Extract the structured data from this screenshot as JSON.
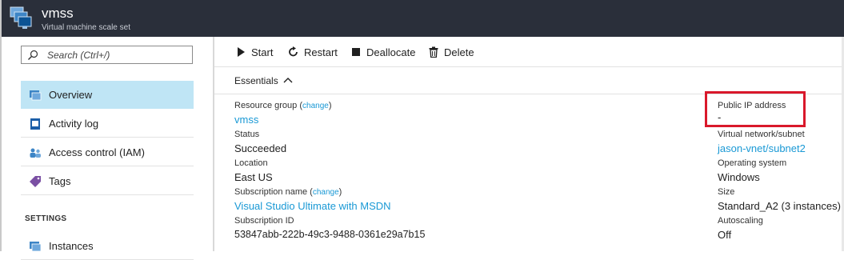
{
  "header": {
    "title": "vmss",
    "subtitle": "Virtual machine scale set",
    "icon": "vm-scale-set-icon"
  },
  "sidebar": {
    "search_placeholder": "Search (Ctrl+/)",
    "items": [
      {
        "label": "Overview",
        "icon": "overview-icon",
        "active": true
      },
      {
        "label": "Activity log",
        "icon": "activity-log-icon",
        "active": false
      },
      {
        "label": "Access control (IAM)",
        "icon": "iam-icon",
        "active": false
      },
      {
        "label": "Tags",
        "icon": "tag-icon",
        "active": false
      }
    ],
    "section_settings": "SETTINGS",
    "settings_items": [
      {
        "label": "Instances",
        "icon": "instances-icon"
      }
    ]
  },
  "toolbar": {
    "start": "Start",
    "restart": "Restart",
    "deallocate": "Deallocate",
    "delete": "Delete"
  },
  "essentials": {
    "label": "Essentials",
    "left": [
      {
        "label": "Resource group",
        "change": "change",
        "value": "vmss",
        "link": true
      },
      {
        "label": "Status",
        "value": "Succeeded"
      },
      {
        "label": "Location",
        "value": "East US"
      },
      {
        "label": "Subscription name",
        "change": "change",
        "value": "Visual Studio Ultimate with MSDN",
        "link": true
      },
      {
        "label": "Subscription ID",
        "value": "53847abb-222b-49c3-9488-0361e29a7b15"
      }
    ],
    "right": [
      {
        "label": "Public IP address",
        "value": "-"
      },
      {
        "label": "Virtual network/subnet",
        "value": "jason-vnet/subnet2",
        "link": true
      },
      {
        "label": "Operating system",
        "value": "Windows"
      },
      {
        "label": "Size",
        "value": "Standard_A2 (3 instances)"
      },
      {
        "label": "Autoscaling",
        "value": "Off"
      }
    ]
  },
  "colors": {
    "header_bg": "#2a2f3a",
    "active_bg": "#bfe5f5",
    "link": "#1a99d5",
    "highlight": "#d9182b"
  }
}
